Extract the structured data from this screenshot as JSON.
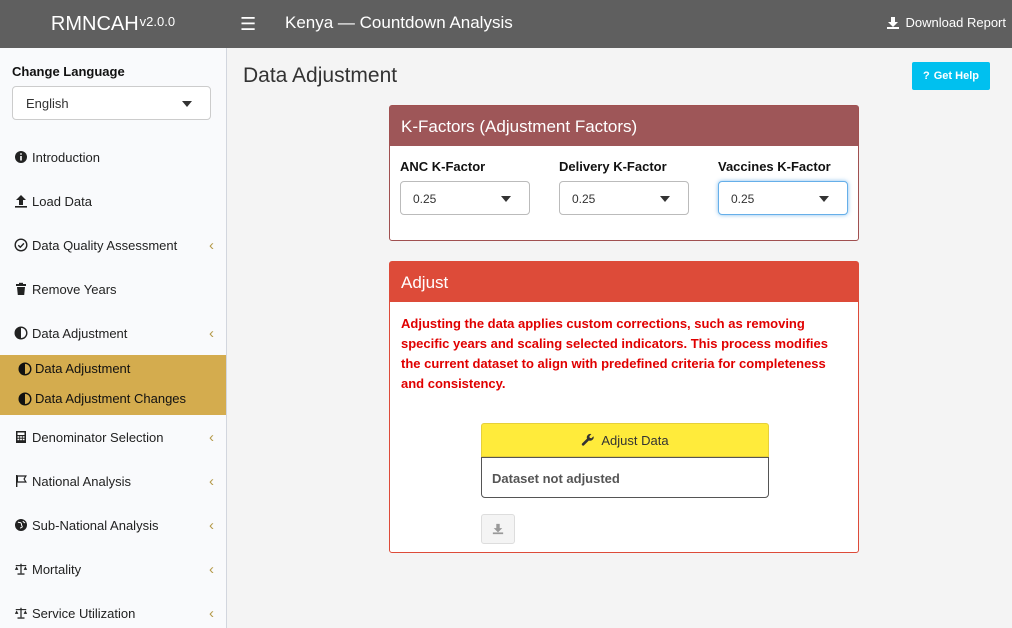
{
  "header": {
    "brand": "RMNCAH",
    "version": "v2.0.0",
    "title": "Kenya — Countdown Analysis",
    "download_label": "Download Report"
  },
  "sidebar": {
    "language_label": "Change Language",
    "language_value": "English",
    "items": [
      {
        "label": "Introduction",
        "icon": "info-circle-icon"
      },
      {
        "label": "Load Data",
        "icon": "upload-icon"
      },
      {
        "label": "Data Quality Assessment",
        "icon": "check-circle-icon"
      },
      {
        "label": "Remove Years",
        "icon": "trash-icon"
      },
      {
        "label": "Data Adjustment",
        "icon": "half-circle-icon"
      },
      {
        "label": "Denominator Selection",
        "icon": "calculator-icon"
      },
      {
        "label": "National Analysis",
        "icon": "flag-icon"
      },
      {
        "label": "Sub-National Analysis",
        "icon": "globe-icon"
      },
      {
        "label": "Mortality",
        "icon": "balance-scale-icon"
      },
      {
        "label": "Service Utilization",
        "icon": "balance-scale-icon"
      }
    ],
    "subitems": [
      {
        "label": "Data Adjustment"
      },
      {
        "label": "Data Adjustment Changes"
      }
    ]
  },
  "main": {
    "page_title": "Data Adjustment",
    "help_label": "Get Help",
    "kfactors": {
      "title": "K-Factors (Adjustment Factors)",
      "anc_label": "ANC K-Factor",
      "anc_value": "0.25",
      "delivery_label": "Delivery K-Factor",
      "delivery_value": "0.25",
      "vaccines_label": "Vaccines K-Factor",
      "vaccines_value": "0.25"
    },
    "adjust": {
      "title": "Adjust",
      "description": "Adjusting the data applies custom corrections, such as removing specific years and scaling selected indicators. This process modifies the current dataset to align with predefined criteria for completeness and consistency.",
      "button_label": "Adjust Data",
      "status": "Dataset not adjusted"
    }
  },
  "colors": {
    "header_bg": "#5f5f5f",
    "submenu_active": "#d4ac4e",
    "kfactor_header": "#9e5658",
    "adjust_header": "#dd4b39",
    "adjust_button": "#ffeb3b",
    "help_button": "#00c0ef",
    "warning_text": "#e00000"
  }
}
